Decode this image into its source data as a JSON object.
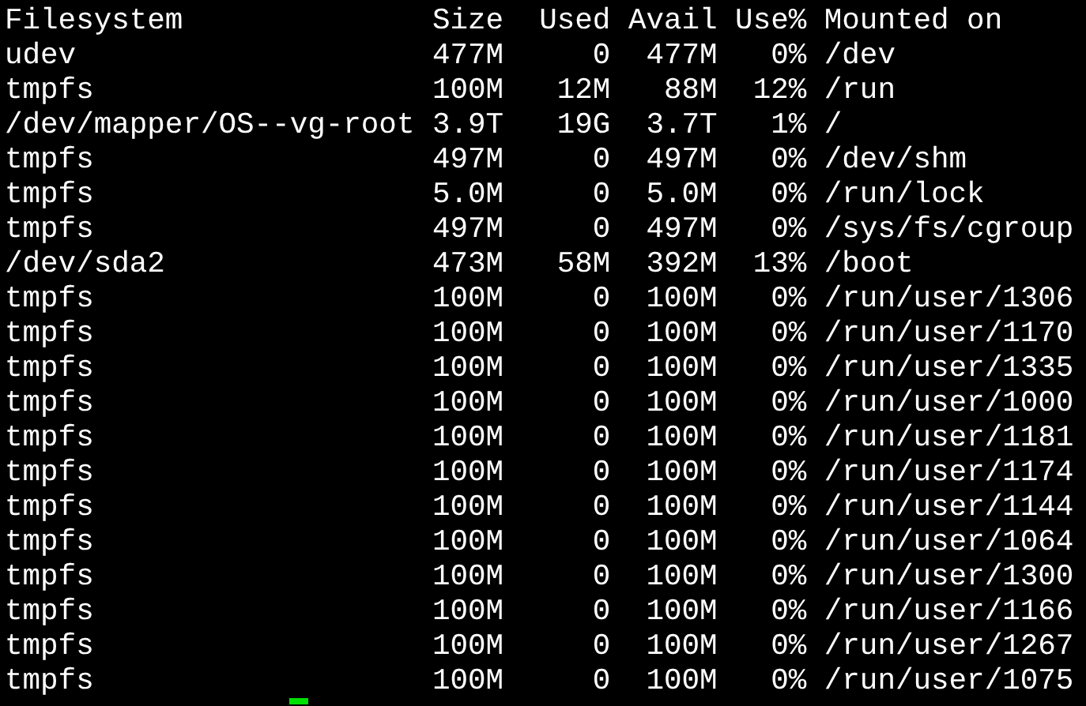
{
  "terminal": {
    "columns": [
      "Filesystem",
      "Size",
      "Used",
      "Avail",
      "Use%",
      "Mounted on"
    ],
    "rows": [
      [
        "udev",
        "477M",
        "0",
        "477M",
        "0%",
        "/dev"
      ],
      [
        "tmpfs",
        "100M",
        "12M",
        "88M",
        "12%",
        "/run"
      ],
      [
        "/dev/mapper/OS--vg-root",
        "3.9T",
        "19G",
        "3.7T",
        "1%",
        "/"
      ],
      [
        "tmpfs",
        "497M",
        "0",
        "497M",
        "0%",
        "/dev/shm"
      ],
      [
        "tmpfs",
        "5.0M",
        "0",
        "5.0M",
        "0%",
        "/run/lock"
      ],
      [
        "tmpfs",
        "497M",
        "0",
        "497M",
        "0%",
        "/sys/fs/cgroup"
      ],
      [
        "/dev/sda2",
        "473M",
        "58M",
        "392M",
        "13%",
        "/boot"
      ],
      [
        "tmpfs",
        "100M",
        "0",
        "100M",
        "0%",
        "/run/user/1306"
      ],
      [
        "tmpfs",
        "100M",
        "0",
        "100M",
        "0%",
        "/run/user/1170"
      ],
      [
        "tmpfs",
        "100M",
        "0",
        "100M",
        "0%",
        "/run/user/1335"
      ],
      [
        "tmpfs",
        "100M",
        "0",
        "100M",
        "0%",
        "/run/user/1000"
      ],
      [
        "tmpfs",
        "100M",
        "0",
        "100M",
        "0%",
        "/run/user/1181"
      ],
      [
        "tmpfs",
        "100M",
        "0",
        "100M",
        "0%",
        "/run/user/1174"
      ],
      [
        "tmpfs",
        "100M",
        "0",
        "100M",
        "0%",
        "/run/user/1144"
      ],
      [
        "tmpfs",
        "100M",
        "0",
        "100M",
        "0%",
        "/run/user/1064"
      ],
      [
        "tmpfs",
        "100M",
        "0",
        "100M",
        "0%",
        "/run/user/1300"
      ],
      [
        "tmpfs",
        "100M",
        "0",
        "100M",
        "0%",
        "/run/user/1166"
      ],
      [
        "tmpfs",
        "100M",
        "0",
        "100M",
        "0%",
        "/run/user/1267"
      ],
      [
        "tmpfs",
        "100M",
        "0",
        "100M",
        "0%",
        "/run/user/1075"
      ]
    ]
  }
}
